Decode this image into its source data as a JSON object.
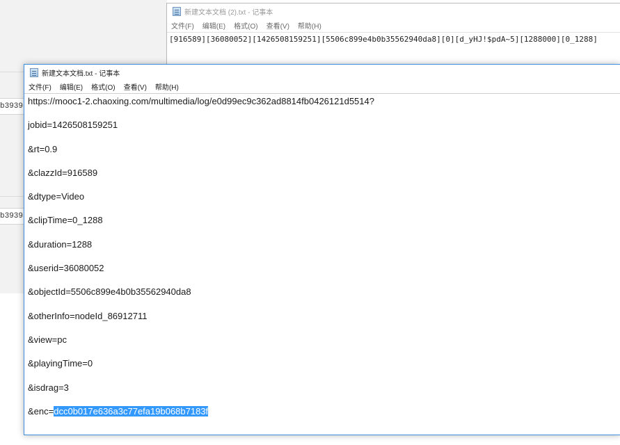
{
  "background": {
    "fields": [
      "b39395",
      "b39395"
    ]
  },
  "window_back": {
    "title": "新建文本文档 (2).txt - 记事本",
    "menu": [
      "文件(F)",
      "编辑(E)",
      "格式(O)",
      "查看(V)",
      "帮助(H)"
    ],
    "content": "[916589][36080052][1426508159251][5506c899e4b0b35562940da8][0][d_yHJ!$pdA~5][1288000][0_1288]"
  },
  "window_front": {
    "title": "新建文本文档.txt - 记事本",
    "menu": [
      "文件(F)",
      "编辑(E)",
      "格式(O)",
      "查看(V)",
      "帮助(H)"
    ],
    "lines": [
      "https://mooc1-2.chaoxing.com/multimedia/log/e0d99ec9c362ad8814fb0426121d5514?",
      "jobid=1426508159251",
      "&rt=0.9",
      "&clazzId=916589",
      "&dtype=Video",
      "&clipTime=0_1288",
      "&duration=1288",
      "&userid=36080052",
      "&objectId=5506c899e4b0b35562940da8",
      "&otherInfo=nodeId_86912711",
      "&view=pc",
      "&playingTime=0",
      "&isdrag=3"
    ],
    "last_line_prefix": "&enc=",
    "last_line_selected": "dcc0b017e636a3c77efa19b068b7183f"
  }
}
